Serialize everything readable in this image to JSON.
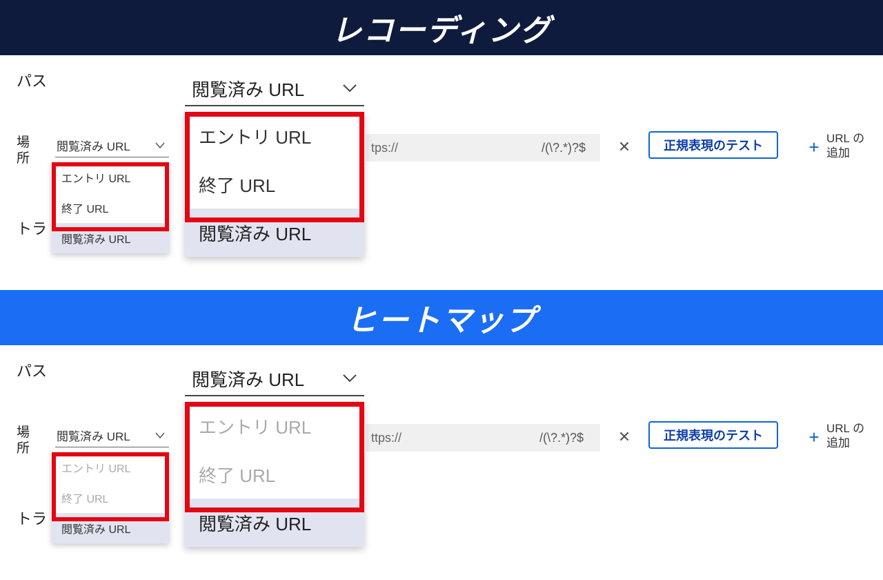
{
  "banners": {
    "recording": "レコーディング",
    "heatmap": "ヒートマップ"
  },
  "labels": {
    "path": "パス",
    "place": "場\n所",
    "tra": "トラ"
  },
  "select": {
    "visited": "閲覧済み URL",
    "entry": "エントリ URL",
    "exit": "終了 URL"
  },
  "url": {
    "left": "tps://",
    "left2": "ttps://",
    "right": "/(\\?.*)?$"
  },
  "buttons": {
    "test": "正規表現のテスト",
    "add_line1": "URL の",
    "add_line2": "追加"
  },
  "icons": {
    "plus": "+",
    "x": "✕"
  }
}
